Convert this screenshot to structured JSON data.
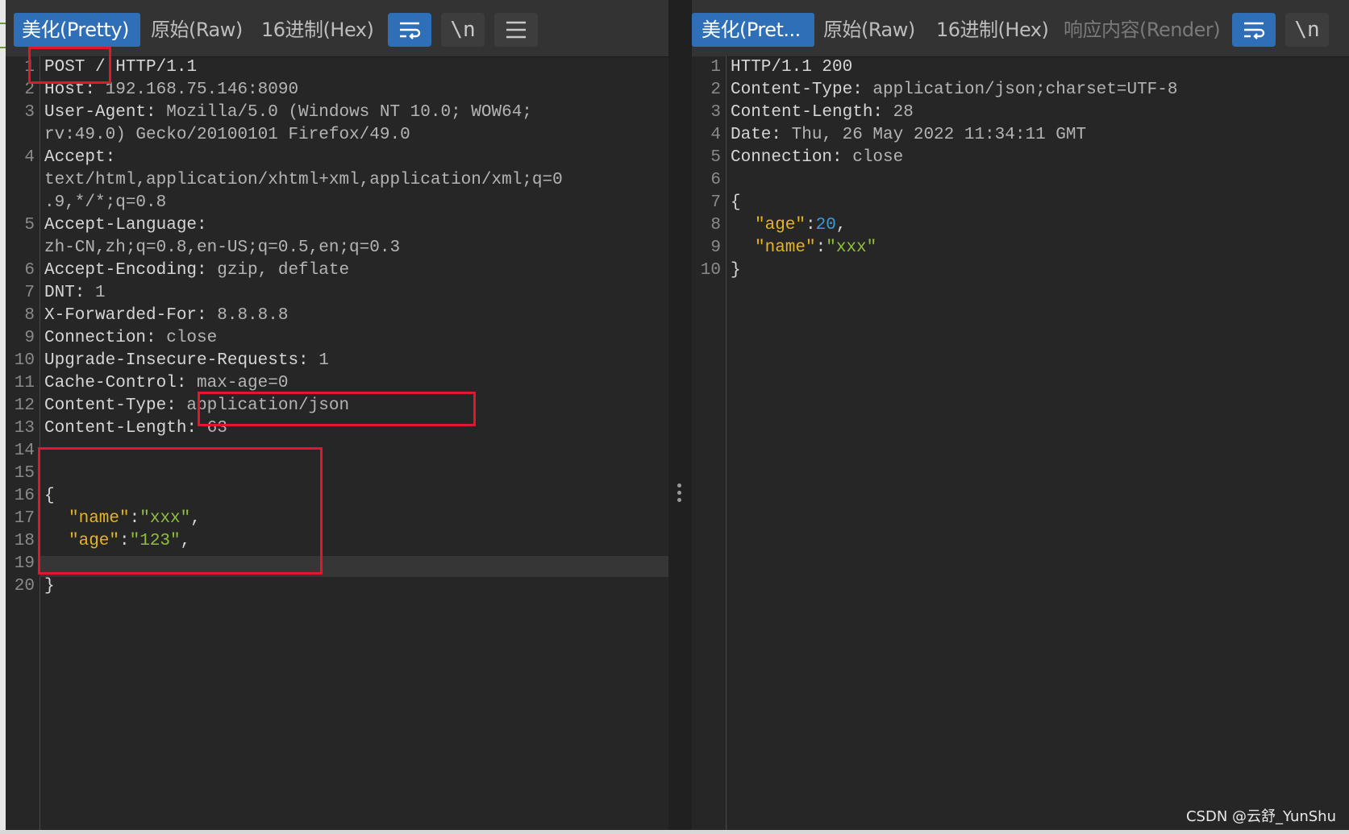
{
  "request_tabs": {
    "pretty": "美化(Pretty)",
    "raw": "原始(Raw)",
    "hex": "16进制(Hex)",
    "newline_btn": "\\n"
  },
  "response_tabs": {
    "pretty": "美化(Pret...",
    "raw": "原始(Raw)",
    "hex": "16进制(Hex)",
    "render": "响应内容(Render)",
    "newline_btn": "\\n"
  },
  "request": {
    "line_numbers": [
      "1",
      "2",
      "3",
      "4",
      "5",
      "6",
      "7",
      "8",
      "9",
      "10",
      "11",
      "12",
      "13",
      "14",
      "15",
      "16",
      "17",
      "18",
      "19",
      "20"
    ],
    "l1_method": "POST",
    "l1_rest": " / HTTP/1.1",
    "l2_key": "Host:",
    "l2_val": " 192.168.75.146:8090",
    "l3_key": "User-Agent:",
    "l3_val": " Mozilla/5.0 (Windows NT 10.0; WOW64;",
    "l3_cont": "rv:49.0) Gecko/20100101 Firefox/49.0",
    "l4_key": "Accept:",
    "l4_cont1": "text/html,application/xhtml+xml,application/xml;q=0",
    "l4_cont2": ".9,*/*;q=0.8",
    "l5_key": "Accept-Language:",
    "l5_cont": "zh-CN,zh;q=0.8,en-US;q=0.5,en;q=0.3",
    "l6_key": "Accept-Encoding:",
    "l6_val": " gzip, deflate",
    "l7_key": "DNT:",
    "l7_val": " 1",
    "l8_key": "X-Forwarded-For:",
    "l8_val": " 8.8.8.8",
    "l9_key": "Connection:",
    "l9_val": " close",
    "l10_key": "Upgrade-Insecure-Requests:",
    "l10_val": " 1",
    "l11_key": "Cache-Control:",
    "l11_val": " max-age=0",
    "l12_key": "Content-Type:",
    "l12_val": " application/json",
    "l13_key": "Content-Length:",
    "l13_val": " 63",
    "l15_brace": "{",
    "l16_key": "\"name\"",
    "l16_colon": ":",
    "l16_val": "\"xxx\"",
    "l16_comma": ",",
    "l17_key": "\"age\"",
    "l17_colon": ":",
    "l17_val": "\"123\"",
    "l17_comma": ",",
    "l19_brace": "}"
  },
  "response": {
    "line_numbers": [
      "1",
      "2",
      "3",
      "4",
      "5",
      "6",
      "7",
      "8",
      "9",
      "10"
    ],
    "l1": "HTTP/1.1 200",
    "l2_key": "Content-Type:",
    "l2_val": " application/json;charset=UTF-8",
    "l3_key": "Content-Length:",
    "l3_val": " 28",
    "l4_key": "Date:",
    "l4_val": " Thu, 26 May 2022 11:34:11 GMT",
    "l5_key": "Connection:",
    "l5_val": " close",
    "l7_brace": "{",
    "l8_key": "\"age\"",
    "l8_colon": ":",
    "l8_val": "20",
    "l8_comma": ",",
    "l9_key": "\"name\"",
    "l9_colon": ":",
    "l9_val": "\"xxx\"",
    "l10_brace": "}"
  },
  "watermark": "CSDN @云舒_YunShu",
  "colors": {
    "accent": "#2f6fb8",
    "highlight_box": "#e0192a",
    "json_key": "#e6b422",
    "json_string": "#8fbf3f",
    "json_number": "#3c9ad8"
  }
}
